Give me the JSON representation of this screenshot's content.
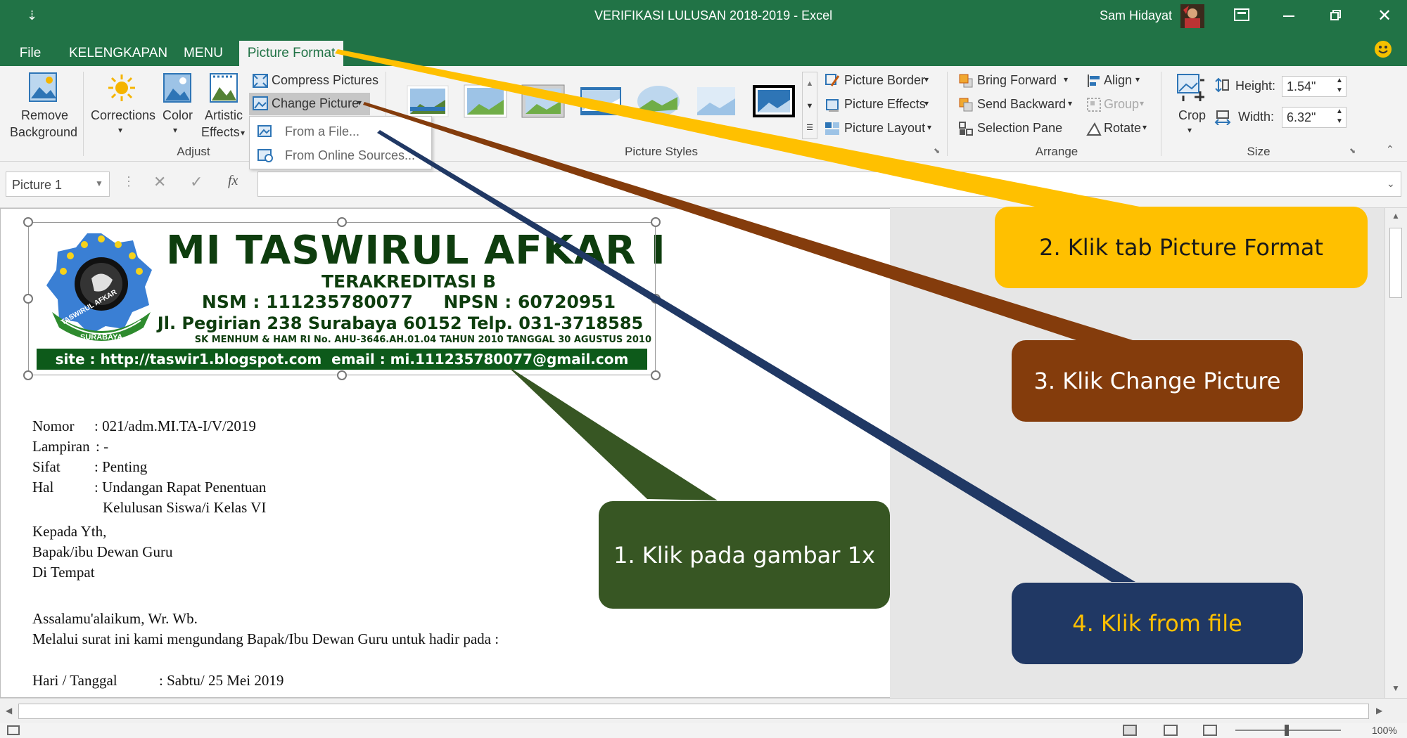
{
  "app": {
    "window_title": "VERIFIKASI LULUSAN 2018-2019  -  Excel",
    "user": "Sam Hidayat",
    "quick_access_symbol": "⇣"
  },
  "tabs": [
    "File",
    "KELENGKAPAN",
    "MENU",
    "Picture Format"
  ],
  "ribbon": {
    "adjust": {
      "remove_background": [
        "Remove",
        "Background"
      ],
      "corrections": "Corrections",
      "color": "Color",
      "artistic_effects": [
        "Artistic",
        "Effects"
      ],
      "compress_pictures": "Compress Pictures",
      "change_picture": "Change Picture",
      "group_label": "Adjust"
    },
    "change_picture_menu": [
      "From a File...",
      "From Online Sources..."
    ],
    "picture_styles": {
      "picture_border": "Picture Border",
      "picture_effects": "Picture Effects",
      "picture_layout": "Picture Layout",
      "group_label": "Picture Styles"
    },
    "arrange": {
      "bring_forward": "Bring Forward",
      "send_backward": "Send Backward",
      "selection_pane": "Selection Pane",
      "align": "Align",
      "group": "Group",
      "rotate": "Rotate",
      "group_label": "Arrange"
    },
    "size": {
      "crop": "Crop",
      "height_label": "Height:",
      "height_value": "1.54\"",
      "width_label": "Width:",
      "width_value": "6.32\"",
      "group_label": "Size"
    }
  },
  "formula_bar": {
    "name_box": "Picture 1",
    "fx": "fx",
    "cancel_symbol": "✕",
    "enter_symbol": "✓",
    "content": ""
  },
  "letterhead": {
    "school_name": "MI TASWIRUL AFKAR I",
    "accreditation": "TERAKREDITASI B",
    "nsm_npsn": "NSM : 111235780077     NPSN : 60720951",
    "address": "Jl. Pegirian 238 Surabaya 60152 Telp. 031-3718585",
    "decree": "SK MENHUM & HAM RI No. AHU-3646.AH.01.04 TAHUN 2010 TANGGAL 30 AGUSTUS 2010",
    "contact": "site : http://taswir1.blogspot.com  email : mi.111235780077@gmail.com",
    "logo_text": [
      "TASWIRUL AFKAR",
      "SURABAYA"
    ]
  },
  "letter": {
    "lines": [
      {
        "label": "Nomor",
        "value": ": 021/adm.MI.TA-I/V/2019"
      },
      {
        "label": "Lampiran",
        "value": ": -"
      },
      {
        "label": "Sifat",
        "value": ": Penting"
      },
      {
        "label": "Hal",
        "value": ": Undangan Rapat Penentuan"
      }
    ],
    "hal_continuation": "Kelulusan Siswa/i Kelas VI",
    "recipient": [
      "Kepada Yth,",
      "Bapak/ibu Dewan Guru",
      "Di Tempat"
    ],
    "greeting": "Assalamu'alaikum, Wr. Wb.",
    "body": "Melalui surat ini kami mengundang Bapak/Ibu Dewan Guru untuk hadir pada :",
    "day_label": "Hari / Tanggal",
    "day_value": ":  Sabtu/ 25 Mei 2019"
  },
  "callouts": [
    {
      "text": "1. Klik pada gambar 1x",
      "color": "#375623",
      "text_color": "#ffffff"
    },
    {
      "text": "2. Klik tab Picture Format",
      "color": "#ffc000",
      "text_color": "#1a1a1a"
    },
    {
      "text": "3. Klik Change Picture",
      "color": "#843c0c",
      "text_color": "#ffffff"
    },
    {
      "text": "4. Klik from file",
      "color": "#203864",
      "text_color": "#ffc000"
    }
  ],
  "status": {
    "zoom": "100%"
  },
  "colors": {
    "excel_green": "#217346",
    "ribbon_bg": "#f3f3f3"
  }
}
